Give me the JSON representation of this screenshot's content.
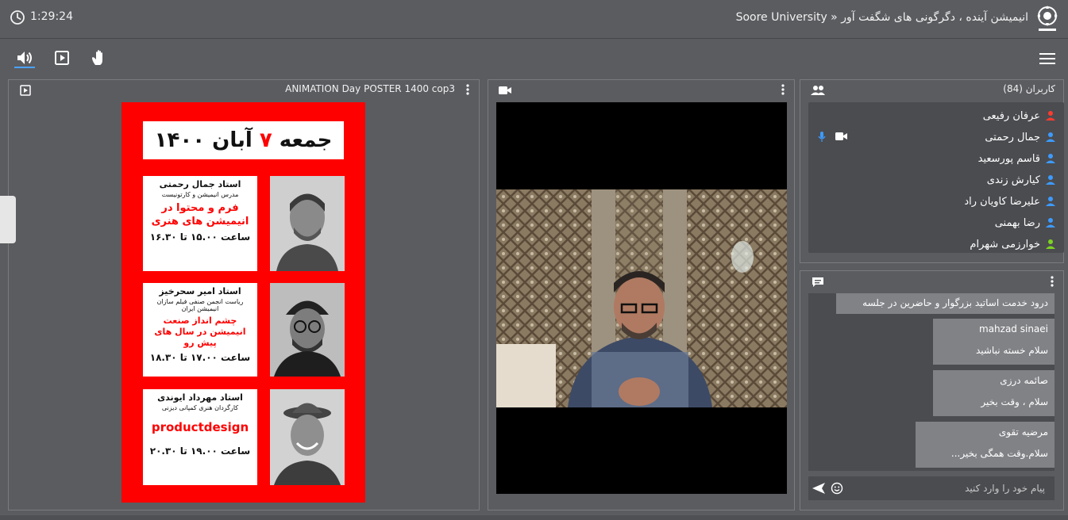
{
  "header": {
    "timer": "1:29:24",
    "session_title": "Soore University » انیمیشن آینده ، دگرگونی های شگفت آور",
    "logo_icon": "university-seal"
  },
  "toolbar": {
    "audio_icon": "speaker-icon",
    "share_icon": "play-box-icon",
    "raise_hand_icon": "raise-hand-icon",
    "menu_icon": "hamburger-menu-icon",
    "accent_color": "#4aa3ff"
  },
  "presentation": {
    "title": "ANIMATION Day POSTER 1400 cop3",
    "poster": {
      "date_prefix": "جمعه",
      "date_day": "۷",
      "date_suffix": "آبان ۱۴۰۰",
      "cards": [
        {
          "name": "استاد جمال رحمتی",
          "role": "مدرس انیمیشن و کارتونیست",
          "topic": "فرم و محتوا در انیمیشن های هنری",
          "time": "ساعت ۱۵.۰۰ تا ۱۶.۳۰"
        },
        {
          "name": "استاد امیر سحرخیز",
          "role": "ریاست انجمن صنفی فیلم سازان انیمیشن ایران",
          "topic": "چشم انداز صنعت انیمیشن در سال های پیش رو",
          "time": "ساعت ۱۷.۰۰ تا ۱۸.۳۰"
        },
        {
          "name": "استاد مهرداد ایوندی",
          "role": "کارگردان هنری کمپانی دیزنی",
          "topic": "productdesign",
          "time": "ساعت ۱۹.۰۰ تا ۲۰.۳۰"
        }
      ]
    }
  },
  "users": {
    "title": "کاربران (84)",
    "list": [
      {
        "name": "عرفان رفیعی",
        "color": "#ff3b30",
        "mic": false,
        "cam": false
      },
      {
        "name": "جمال رحمتی",
        "color": "#3d9bff",
        "mic": true,
        "cam": true
      },
      {
        "name": "قاسم پورسعید",
        "color": "#3d9bff",
        "mic": false,
        "cam": false
      },
      {
        "name": "کیارش زندی",
        "color": "#3d9bff",
        "mic": false,
        "cam": false
      },
      {
        "name": "علیرضا کاویان راد",
        "color": "#3d9bff",
        "mic": false,
        "cam": false
      },
      {
        "name": "رضا بهمنی",
        "color": "#3d9bff",
        "mic": false,
        "cam": false
      },
      {
        "name": "خوارزمی شهرام",
        "color": "#7ed321",
        "mic": false,
        "cam": false
      }
    ]
  },
  "chat": {
    "messages": [
      {
        "sender": "",
        "text": "درود خدمت اساتید بزرگوار و حاضرین در جلسه"
      },
      {
        "sender": "mahzad sinaei",
        "text": "سلام خسته نباشید"
      },
      {
        "sender": "صائمه درزی",
        "text": "سلام ، وقت بخیر"
      },
      {
        "sender": "مرضیه تقوی",
        "text": "سلام.وقت همگی بخیر..."
      }
    ],
    "input_placeholder": "پیام خود را وارد کنید"
  }
}
